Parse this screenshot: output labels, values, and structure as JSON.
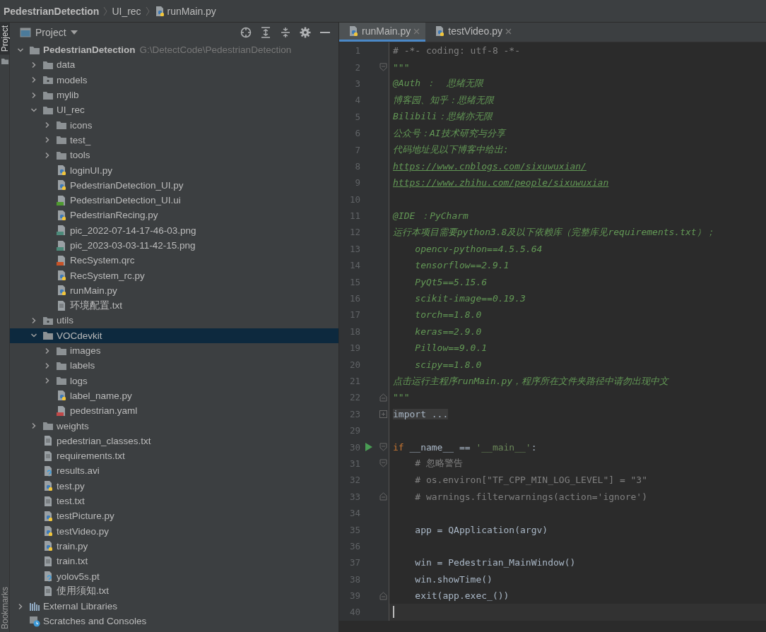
{
  "breadcrumb": [
    "PedestrianDetection",
    "UI_rec",
    "runMain.py"
  ],
  "side_strip": {
    "top_tab": {
      "label": "Project",
      "selected": true
    },
    "bottom_tab": {
      "label": "Bookmarks",
      "selected": false
    }
  },
  "project_panel": {
    "title": "Project",
    "tree": [
      {
        "label": "PedestrianDetection",
        "path": "G:\\DetectCode\\PedestrianDetection",
        "kind": "folder",
        "expanded": true,
        "selected": false,
        "children": [
          {
            "label": "data",
            "kind": "folder",
            "expanded": false,
            "selected": false
          },
          {
            "label": "models",
            "kind": "package",
            "expanded": false,
            "selected": false
          },
          {
            "label": "mylib",
            "kind": "folder",
            "expanded": false,
            "selected": false
          },
          {
            "label": "UI_rec",
            "kind": "folder",
            "expanded": true,
            "selected": false,
            "children": [
              {
                "label": "icons",
                "kind": "folder",
                "expanded": false,
                "selected": false
              },
              {
                "label": "test_",
                "kind": "folder",
                "expanded": false,
                "selected": false
              },
              {
                "label": "tools",
                "kind": "folder",
                "expanded": false,
                "selected": false
              },
              {
                "label": "loginUI.py",
                "kind": "python",
                "selected": false
              },
              {
                "label": "PedestrianDetection_UI.py",
                "kind": "python",
                "selected": false
              },
              {
                "label": "PedestrianDetection_UI.ui",
                "kind": "ui",
                "selected": false
              },
              {
                "label": "PedestrianRecing.py",
                "kind": "python",
                "selected": false
              },
              {
                "label": "pic_2022-07-14-17-46-03.png",
                "kind": "image",
                "selected": false
              },
              {
                "label": "pic_2023-03-03-11-42-15.png",
                "kind": "image",
                "selected": false
              },
              {
                "label": "RecSystem.qrc",
                "kind": "qrc",
                "selected": false
              },
              {
                "label": "RecSystem_rc.py",
                "kind": "python",
                "selected": false
              },
              {
                "label": "runMain.py",
                "kind": "python",
                "selected": false
              },
              {
                "label": "环境配置.txt",
                "kind": "text",
                "selected": false
              }
            ]
          },
          {
            "label": "utils",
            "kind": "package",
            "expanded": false,
            "selected": false
          },
          {
            "label": "VOCdevkit",
            "kind": "folder",
            "expanded": true,
            "selected": true,
            "children": [
              {
                "label": "images",
                "kind": "folder",
                "expanded": false,
                "selected": false
              },
              {
                "label": "labels",
                "kind": "folder",
                "expanded": false,
                "selected": false
              },
              {
                "label": "logs",
                "kind": "folder",
                "expanded": false,
                "selected": false
              },
              {
                "label": "label_name.py",
                "kind": "python",
                "selected": false
              },
              {
                "label": "pedestrian.yaml",
                "kind": "yaml",
                "selected": false
              }
            ]
          },
          {
            "label": "weights",
            "kind": "folder",
            "expanded": false,
            "selected": false
          },
          {
            "label": "pedestrian_classes.txt",
            "kind": "text",
            "selected": false
          },
          {
            "label": "requirements.txt",
            "kind": "text",
            "selected": false
          },
          {
            "label": "results.avi",
            "kind": "unknown",
            "selected": false
          },
          {
            "label": "test.py",
            "kind": "python",
            "selected": false
          },
          {
            "label": "test.txt",
            "kind": "text",
            "selected": false
          },
          {
            "label": "testPicture.py",
            "kind": "python",
            "selected": false
          },
          {
            "label": "testVideo.py",
            "kind": "python",
            "selected": false
          },
          {
            "label": "train.py",
            "kind": "python",
            "selected": false
          },
          {
            "label": "train.txt",
            "kind": "text",
            "selected": false
          },
          {
            "label": "yolov5s.pt",
            "kind": "unknown",
            "selected": false
          },
          {
            "label": "使用须知.txt",
            "kind": "text",
            "selected": false
          }
        ]
      },
      {
        "label": "External Libraries",
        "kind": "libraries",
        "expanded": false,
        "selected": false
      },
      {
        "label": "Scratches and Consoles",
        "kind": "scratches",
        "selected": false
      }
    ]
  },
  "editor_tabs": [
    {
      "label": "runMain.py",
      "selected": true
    },
    {
      "label": "testVideo.py",
      "selected": false
    }
  ],
  "code_lines": [
    {
      "number": "1",
      "segments": [
        {
          "text": "# -*- coding: utf-8 -*-",
          "kind": "comment"
        }
      ]
    },
    {
      "number": "2",
      "fold_start": true,
      "segments": [
        {
          "text": "\"\"\"",
          "kind": "docstring"
        }
      ]
    },
    {
      "number": "3",
      "segments": [
        {
          "text": "@Auth ：  思绪无限",
          "kind": "docstring"
        }
      ]
    },
    {
      "number": "4",
      "segments": [
        {
          "text": "博客园、知乎：思绪无限",
          "kind": "docstring"
        }
      ]
    },
    {
      "number": "5",
      "segments": [
        {
          "text": "Bilibili：思绪亦无限",
          "kind": "docstring"
        }
      ]
    },
    {
      "number": "6",
      "segments": [
        {
          "text": "公众号：AI技术研究与分享",
          "kind": "docstring"
        }
      ]
    },
    {
      "number": "7",
      "segments": [
        {
          "text": "代码地址见以下博客中给出:",
          "kind": "docstring"
        }
      ]
    },
    {
      "number": "8",
      "segments": [
        {
          "text": "https://www.cnblogs.com/sixuwuxian/",
          "kind": "link"
        }
      ]
    },
    {
      "number": "9",
      "segments": [
        {
          "text": "https://www.zhihu.com/people/sixuwuxian",
          "kind": "link"
        }
      ]
    },
    {
      "number": "10"
    },
    {
      "number": "11",
      "segments": [
        {
          "text": "@IDE ：PyCharm",
          "kind": "docstring"
        }
      ]
    },
    {
      "number": "12",
      "segments": [
        {
          "text": "运行本项目需要python3.8及以下依赖库（完整库见requirements.txt）；",
          "kind": "docstring"
        }
      ]
    },
    {
      "number": "13",
      "segments": [
        {
          "text": "    opencv-python==4.5.5.64",
          "kind": "docstring"
        }
      ]
    },
    {
      "number": "14",
      "segments": [
        {
          "text": "    tensorflow==2.9.1",
          "kind": "docstring"
        }
      ]
    },
    {
      "number": "15",
      "segments": [
        {
          "text": "    PyQt5==5.15.6",
          "kind": "docstring"
        }
      ]
    },
    {
      "number": "16",
      "segments": [
        {
          "text": "    scikit-image==0.19.3",
          "kind": "docstring"
        }
      ]
    },
    {
      "number": "17",
      "segments": [
        {
          "text": "    torch==1.8.0",
          "kind": "docstring"
        }
      ]
    },
    {
      "number": "18",
      "segments": [
        {
          "text": "    keras==2.9.0",
          "kind": "docstring"
        }
      ]
    },
    {
      "number": "19",
      "segments": [
        {
          "text": "    Pillow==9.0.1",
          "kind": "docstring"
        }
      ]
    },
    {
      "number": "20",
      "segments": [
        {
          "text": "    scipy==1.8.0",
          "kind": "docstring"
        }
      ]
    },
    {
      "number": "21",
      "segments": [
        {
          "text": "点击运行主程序runMain.py，程序所在文件夹路径中请勿出现中文",
          "kind": "docstring"
        }
      ]
    },
    {
      "number": "22",
      "fold_end": true,
      "segments": [
        {
          "text": "\"\"\"",
          "kind": "docstring"
        }
      ]
    },
    {
      "number": "23",
      "folded": true,
      "segments": [
        {
          "text": "import ...",
          "kind": "folded"
        }
      ]
    },
    {
      "number": "29"
    },
    {
      "number": "30",
      "run": true,
      "fold_start": true,
      "segments": [
        {
          "text": "if",
          "kind": "keyword"
        },
        {
          "text": " __name__ == ",
          "kind": "plain"
        },
        {
          "text": "'__main__'",
          "kind": "string"
        },
        {
          "text": ":",
          "kind": "plain"
        }
      ]
    },
    {
      "number": "31",
      "fold_start": true,
      "segments": [
        {
          "text": "    # 忽略警告",
          "kind": "comment"
        }
      ]
    },
    {
      "number": "32",
      "segments": [
        {
          "text": "    # os.environ[\"TF_CPP_MIN_LOG_LEVEL\"] = \"3\"",
          "kind": "comment"
        }
      ]
    },
    {
      "number": "33",
      "fold_end": true,
      "segments": [
        {
          "text": "    # warnings.filterwarnings(action='ignore')",
          "kind": "comment"
        }
      ]
    },
    {
      "number": "34"
    },
    {
      "number": "35",
      "segments": [
        {
          "text": "    app = QApplication(argv)",
          "kind": "plain"
        }
      ]
    },
    {
      "number": "36"
    },
    {
      "number": "37",
      "segments": [
        {
          "text": "    win = Pedestrian_MainWindow()",
          "kind": "plain"
        }
      ]
    },
    {
      "number": "38",
      "segments": [
        {
          "text": "    win.showTime()",
          "kind": "plain"
        }
      ]
    },
    {
      "number": "39",
      "fold_end": true,
      "segments": [
        {
          "text": "    exit(app.exec_())",
          "kind": "plain"
        }
      ]
    },
    {
      "number": "40",
      "current": true
    }
  ]
}
